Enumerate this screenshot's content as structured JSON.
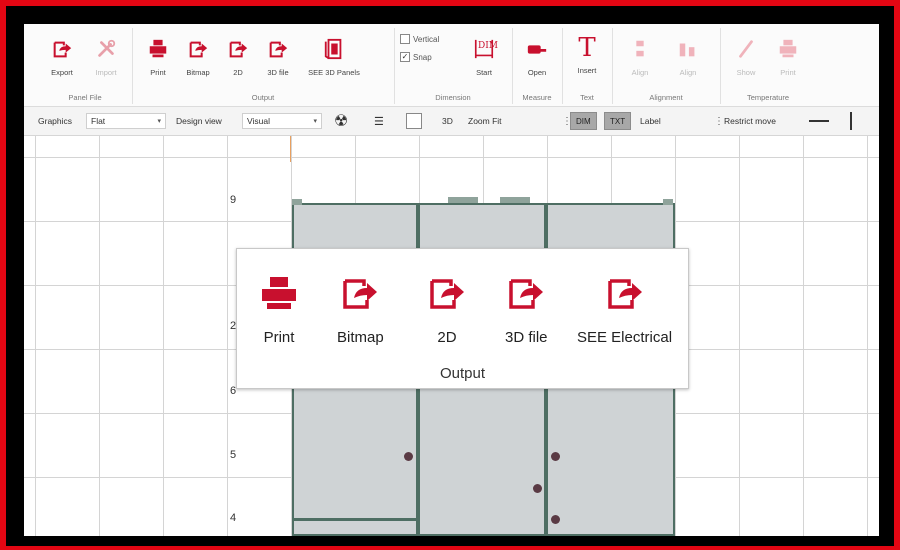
{
  "ribbon": {
    "groups": {
      "panel_file": "Panel File",
      "output": "Output",
      "dimension": "Dimension",
      "measure": "Measure",
      "text": "Text",
      "alignment": "Alignment",
      "temperature": "Temperature"
    },
    "buttons": {
      "export": "Export",
      "import": "Import",
      "print": "Print",
      "bitmap": "Bitmap",
      "2d": "2D",
      "3dfile": "3D file",
      "see3d": "SEE 3D Panels",
      "start": "Start",
      "open": "Open",
      "insert": "Insert",
      "align": "Align",
      "align2": "Align",
      "show": "Show",
      "print2": "Print"
    },
    "checks": {
      "vertical": "Vertical",
      "snap": "Snap",
      "snap_checked": "✓"
    },
    "dim_icon_text": "DIM",
    "text_icon_text": "T"
  },
  "toolbar": {
    "graphics_label": "Graphics",
    "graphics_value": "Flat",
    "design_view_label": "Design view",
    "design_view_value": "Visual",
    "mode_3d": "3D",
    "zoom_fit": "Zoom Fit",
    "dim_btn": "DIM",
    "txt_btn": "TXT",
    "label_value": "Label",
    "restrict_move": "Restrict move"
  },
  "canvas": {
    "ruler": [
      "9",
      "2",
      "6",
      "5",
      "4"
    ]
  },
  "popup": {
    "buttons": [
      "Print",
      "Bitmap",
      "2D",
      "3D file",
      "SEE Electrical"
    ],
    "group_label": "Output"
  },
  "colors": {
    "accent": "#c8102e",
    "frame": "#e30613",
    "cabinet": "#cfd3d5",
    "cabinet_border": "#4e6e63"
  }
}
